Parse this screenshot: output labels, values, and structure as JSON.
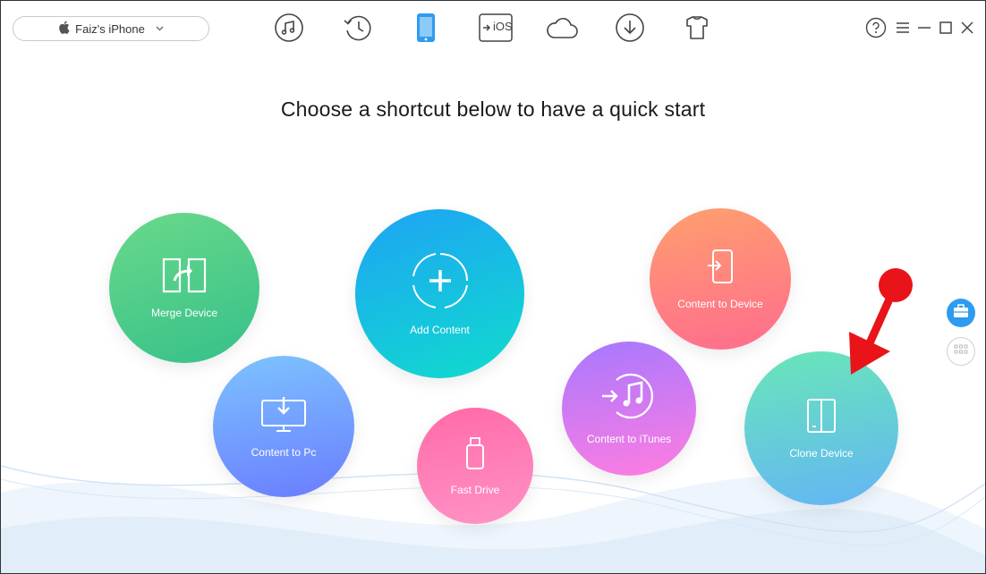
{
  "device": {
    "name": "Faiz's iPhone"
  },
  "nav": {
    "items": [
      "music",
      "history",
      "device",
      "ios-transfer",
      "icloud",
      "download",
      "toolkit"
    ],
    "ios_label": "iOS",
    "active": "device"
  },
  "headline": "Choose a shortcut below to have a quick start",
  "shortcuts": {
    "merge_device": "Merge Device",
    "add_content": "Add Content",
    "content_to_device": "Content to Device",
    "content_to_pc": "Content to Pc",
    "fast_drive": "Fast Drive",
    "content_to_itunes": "Content to iTunes",
    "clone_device": "Clone Device"
  },
  "colors": {
    "accent": "#2f9bf0",
    "merge": [
      "#6ad98a",
      "#35c08a"
    ],
    "add": [
      "#1ea3f5",
      "#10dccd"
    ],
    "to_device": [
      "#ff9f6e",
      "#ff6c8e"
    ],
    "to_pc": [
      "#7dc3ff",
      "#6a7dff"
    ],
    "fast_drive": [
      "#ff6aa8",
      "#ff93c6"
    ],
    "itunes": [
      "#a778ff",
      "#ff7de1"
    ],
    "clone": [
      "#69e6b8",
      "#63b5f5"
    ],
    "arrow": "#e8141a"
  }
}
